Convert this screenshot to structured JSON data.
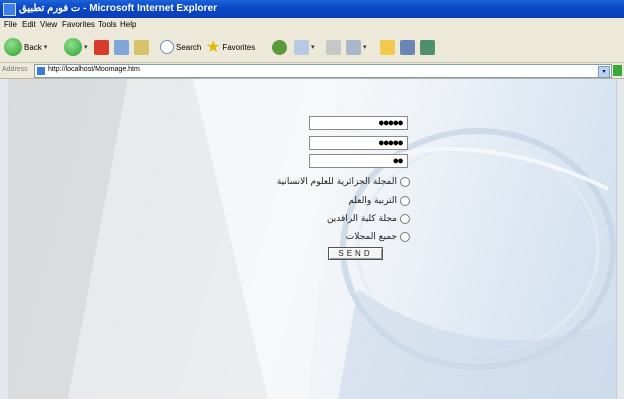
{
  "window": {
    "title": "ت فورم تطبيق - Microsoft Internet Explorer"
  },
  "menu": [
    "File",
    "Edit",
    "View",
    "Favorites",
    "Tools",
    "Help"
  ],
  "toolbar": {
    "back": "Back",
    "search": "Search",
    "favorites": "Favorites"
  },
  "address": {
    "label": "Address",
    "url": "http://localhost/Moomage.htm"
  },
  "form": {
    "fields": [
      {
        "value": "●●●●●"
      },
      {
        "value": "●●●●●"
      },
      {
        "value": "●●"
      }
    ],
    "options": [
      {
        "label": "المجلة الجزائرية للعلوم الانسانية"
      },
      {
        "label": "التربية والعلم"
      },
      {
        "label": "مجلة كلية الرافدين"
      },
      {
        "label": "جميع المجلات"
      }
    ],
    "send_label": "SEND"
  },
  "colors": {
    "titlebar": "#0a46c4",
    "chrome": "#ece9d8",
    "content_bg": "#eef2f7"
  }
}
